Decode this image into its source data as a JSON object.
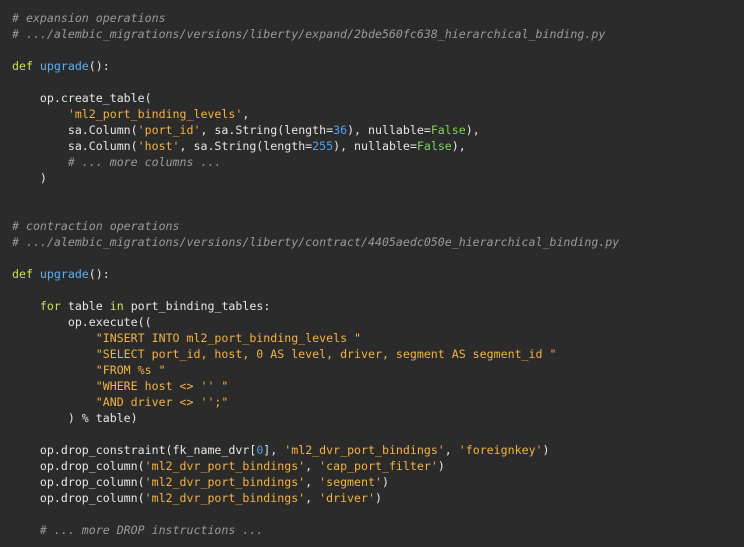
{
  "lines": [
    [
      {
        "t": "cm",
        "v": "# expansion operations"
      }
    ],
    [
      {
        "t": "cm",
        "v": "# .../alembic_migrations/versions/liberty/expand/2bde560fc638_hierarchical_binding.py"
      }
    ],
    [],
    [
      {
        "t": "kw",
        "v": "def "
      },
      {
        "t": "fn",
        "v": "upgrade"
      },
      {
        "t": "tx",
        "v": "():"
      }
    ],
    [],
    [
      {
        "t": "tx",
        "v": "    op.create_table("
      }
    ],
    [
      {
        "t": "tx",
        "v": "        "
      },
      {
        "t": "st",
        "v": "'ml2_port_binding_levels'"
      },
      {
        "t": "tx",
        "v": ","
      }
    ],
    [
      {
        "t": "tx",
        "v": "        sa.Column("
      },
      {
        "t": "st",
        "v": "'port_id'"
      },
      {
        "t": "tx",
        "v": ", sa.String(length="
      },
      {
        "t": "nm",
        "v": "36"
      },
      {
        "t": "tx",
        "v": "), nullable="
      },
      {
        "t": "bo",
        "v": "False"
      },
      {
        "t": "tx",
        "v": "),"
      }
    ],
    [
      {
        "t": "tx",
        "v": "        sa.Column("
      },
      {
        "t": "st",
        "v": "'host'"
      },
      {
        "t": "tx",
        "v": ", sa.String(length="
      },
      {
        "t": "nm",
        "v": "255"
      },
      {
        "t": "tx",
        "v": "), nullable="
      },
      {
        "t": "bo",
        "v": "False"
      },
      {
        "t": "tx",
        "v": "),"
      }
    ],
    [
      {
        "t": "tx",
        "v": "        "
      },
      {
        "t": "cm",
        "v": "# ... more columns ..."
      }
    ],
    [
      {
        "t": "tx",
        "v": "    )"
      }
    ],
    [],
    [],
    [
      {
        "t": "cm",
        "v": "# contraction operations"
      }
    ],
    [
      {
        "t": "cm",
        "v": "# .../alembic_migrations/versions/liberty/contract/4405aedc050e_hierarchical_binding.py"
      }
    ],
    [],
    [
      {
        "t": "kw",
        "v": "def "
      },
      {
        "t": "fn",
        "v": "upgrade"
      },
      {
        "t": "tx",
        "v": "():"
      }
    ],
    [],
    [
      {
        "t": "tx",
        "v": "    "
      },
      {
        "t": "kw",
        "v": "for"
      },
      {
        "t": "tx",
        "v": " table "
      },
      {
        "t": "kw",
        "v": "in"
      },
      {
        "t": "tx",
        "v": " port_binding_tables:"
      }
    ],
    [
      {
        "t": "tx",
        "v": "        op.execute(("
      }
    ],
    [
      {
        "t": "tx",
        "v": "            "
      },
      {
        "t": "st",
        "v": "\"INSERT INTO ml2_port_binding_levels \""
      }
    ],
    [
      {
        "t": "tx",
        "v": "            "
      },
      {
        "t": "st",
        "v": "\"SELECT port_id, host, 0 AS level, driver, segment AS segment_id \""
      }
    ],
    [
      {
        "t": "tx",
        "v": "            "
      },
      {
        "t": "st",
        "v": "\"FROM %s \""
      }
    ],
    [
      {
        "t": "tx",
        "v": "            "
      },
      {
        "t": "st",
        "v": "\"WHERE host <> '' \""
      }
    ],
    [
      {
        "t": "tx",
        "v": "            "
      },
      {
        "t": "st",
        "v": "\"AND driver <> '';\""
      }
    ],
    [
      {
        "t": "tx",
        "v": "        ) % table)"
      }
    ],
    [],
    [
      {
        "t": "tx",
        "v": "    op.drop_constraint(fk_name_dvr["
      },
      {
        "t": "nm",
        "v": "0"
      },
      {
        "t": "tx",
        "v": "], "
      },
      {
        "t": "st",
        "v": "'ml2_dvr_port_bindings'"
      },
      {
        "t": "tx",
        "v": ", "
      },
      {
        "t": "st",
        "v": "'foreignkey'"
      },
      {
        "t": "tx",
        "v": ")"
      }
    ],
    [
      {
        "t": "tx",
        "v": "    op.drop_column("
      },
      {
        "t": "st",
        "v": "'ml2_dvr_port_bindings'"
      },
      {
        "t": "tx",
        "v": ", "
      },
      {
        "t": "st",
        "v": "'cap_port_filter'"
      },
      {
        "t": "tx",
        "v": ")"
      }
    ],
    [
      {
        "t": "tx",
        "v": "    op.drop_column("
      },
      {
        "t": "st",
        "v": "'ml2_dvr_port_bindings'"
      },
      {
        "t": "tx",
        "v": ", "
      },
      {
        "t": "st",
        "v": "'segment'"
      },
      {
        "t": "tx",
        "v": ")"
      }
    ],
    [
      {
        "t": "tx",
        "v": "    op.drop_column("
      },
      {
        "t": "st",
        "v": "'ml2_dvr_port_bindings'"
      },
      {
        "t": "tx",
        "v": ", "
      },
      {
        "t": "st",
        "v": "'driver'"
      },
      {
        "t": "tx",
        "v": ")"
      }
    ],
    [],
    [
      {
        "t": "tx",
        "v": "    "
      },
      {
        "t": "cm",
        "v": "# ... more DROP instructions ..."
      }
    ]
  ]
}
